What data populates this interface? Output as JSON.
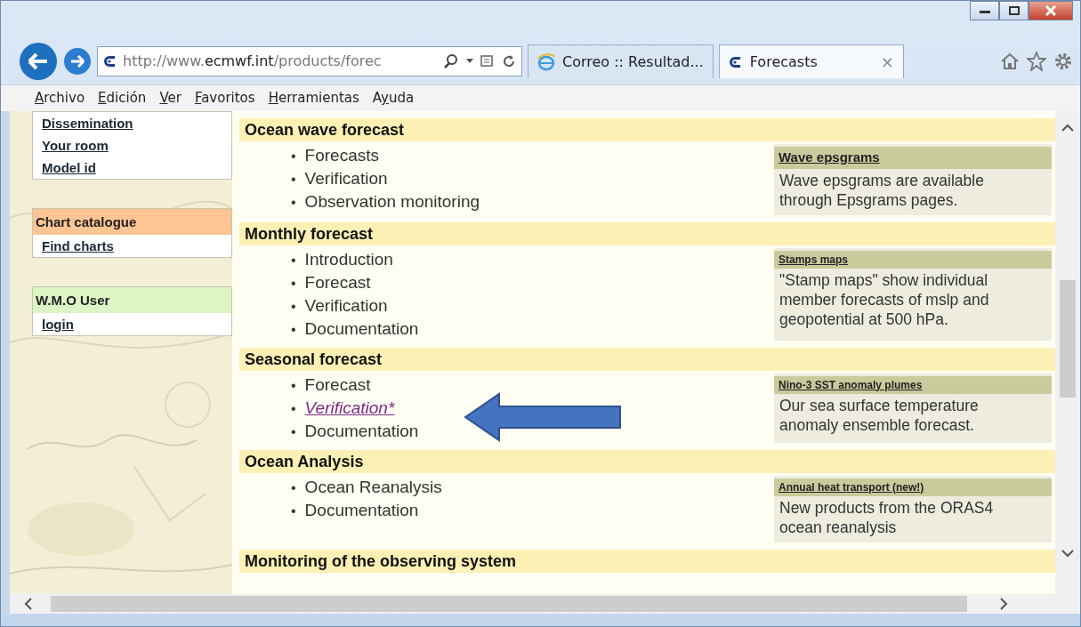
{
  "browser": {
    "address": {
      "prefix": "http://www.",
      "domain": "ecmwf.int",
      "path": "/products/forec"
    },
    "tabs": [
      {
        "label": "Correo :: Resultad...",
        "selected": false,
        "kind": "mail"
      },
      {
        "label": "Forecasts",
        "selected": true,
        "kind": "site",
        "close": "×"
      }
    ],
    "menu": [
      {
        "key": "A",
        "after": "rchivo"
      },
      {
        "key": "E",
        "after": "dición"
      },
      {
        "key": "V",
        "after": "er"
      },
      {
        "key": "F",
        "after": "avoritos"
      },
      {
        "key": "H",
        "after": "erramientas"
      },
      {
        "before": "A",
        "key": "y",
        "after": "uda"
      }
    ]
  },
  "sidebar": [
    {
      "items": [
        "Dissemination",
        "Your room",
        "Model id"
      ]
    },
    {
      "title": "Chart catalogue",
      "color": "#fdc593",
      "items": [
        "Find charts"
      ]
    },
    {
      "title": "W.M.O User",
      "color": "#dcf5c4",
      "items": [
        "login"
      ]
    }
  ],
  "sections": [
    {
      "heading": "Ocean wave forecast",
      "links": [
        {
          "bullet": "•",
          "label": "Forecasts",
          "visited": false
        },
        {
          "bullet": "•",
          "label": "Verification",
          "visited": false
        },
        {
          "bullet": "•",
          "label": "Observation monitoring",
          "visited": false
        }
      ],
      "box": {
        "kind": "featured",
        "title": "Wave epsgrams",
        "text": "Wave epsgrams are available through Epsgrams pages."
      }
    },
    {
      "heading": "Monthly forecast",
      "links": [
        {
          "bullet": "•",
          "label": "Introduction",
          "visited": false
        },
        {
          "bullet": "•",
          "label": "Forecast",
          "visited": false
        },
        {
          "bullet": "•",
          "label": "Verification",
          "visited": false
        },
        {
          "bullet": "•",
          "label": "Documentation",
          "visited": false
        }
      ],
      "box": {
        "kind": "plain",
        "title": "Stamps maps",
        "text": "\"Stamp maps\" show individual member forecasts of mslp and geopotential at 500 hPa."
      }
    },
    {
      "heading": "Seasonal forecast",
      "links": [
        {
          "bullet": "•",
          "label": "Forecast",
          "visited": false
        },
        {
          "bullet": "•",
          "label": "Verification*",
          "visited": true
        },
        {
          "bullet": "•",
          "label": "Documentation",
          "visited": false
        }
      ],
      "box": {
        "kind": "plain",
        "title": "Nino-3 SST anomaly plumes",
        "text": "Our sea surface temperature anomaly ensemble forecast."
      }
    },
    {
      "heading": "Ocean Analysis",
      "links": [
        {
          "bullet": "•",
          "label": "Ocean Reanalysis",
          "visited": false
        },
        {
          "bullet": "•",
          "label": "Documentation",
          "visited": false
        }
      ],
      "box": {
        "kind": "plain",
        "title": "Annual heat transport (new!)",
        "text": "New products from the ORAS4 ocean reanalysis"
      }
    },
    {
      "heading": "Monitoring of the observing system"
    }
  ]
}
